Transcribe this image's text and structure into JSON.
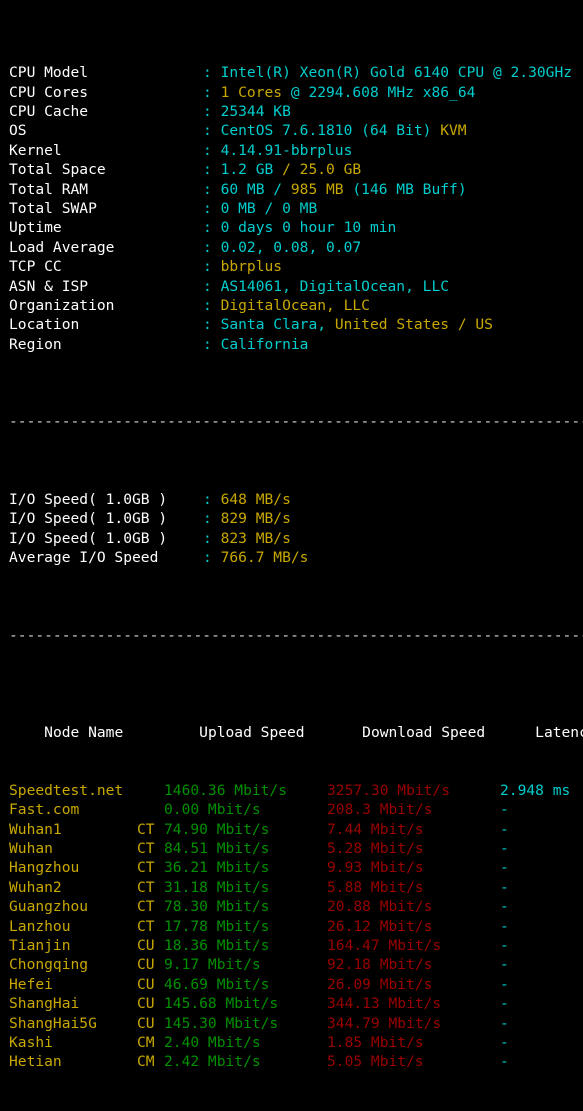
{
  "terminal": {
    "colors": {
      "background": "#000000",
      "label": "#ffffff",
      "cyan": "#00cdcd",
      "yellow": "#c8a800",
      "green": "#009000",
      "red": "#990000",
      "divider": "#cfd8d8"
    },
    "divider": "-------------------------------------------------------------------------------"
  },
  "sysinfo": [
    {
      "label": "CPU Model",
      "sep": ":",
      "parts": [
        {
          "text": "Intel(R) Xeon(R) Gold 6140 CPU @ 2.30GHz",
          "color": "cyan"
        }
      ]
    },
    {
      "label": "CPU Cores",
      "sep": ":",
      "parts": [
        {
          "text": "1 Cores",
          "color": "yellow"
        },
        {
          "text": " @ 2294.608 MHz ",
          "color": "cyan"
        },
        {
          "text": "x86_64",
          "color": "cyan"
        }
      ]
    },
    {
      "label": "CPU Cache",
      "sep": ":",
      "parts": [
        {
          "text": "25344 KB",
          "color": "cyan"
        }
      ]
    },
    {
      "label": "OS",
      "sep": ":",
      "parts": [
        {
          "text": "CentOS 7.6.1810 (64 Bit) ",
          "color": "cyan"
        },
        {
          "text": "KVM",
          "color": "yellow"
        }
      ]
    },
    {
      "label": "Kernel",
      "sep": ":",
      "parts": [
        {
          "text": "4.14.91-bbrplus",
          "color": "cyan"
        }
      ]
    },
    {
      "label": "Total Space",
      "sep": ":",
      "parts": [
        {
          "text": "1.2 GB ",
          "color": "cyan"
        },
        {
          "text": "/ 25.0 GB",
          "color": "yellow"
        }
      ]
    },
    {
      "label": "Total RAM",
      "sep": ":",
      "parts": [
        {
          "text": "60 MB / ",
          "color": "cyan"
        },
        {
          "text": "985 MB",
          "color": "yellow"
        },
        {
          "text": " (146 MB Buff)",
          "color": "cyan"
        }
      ]
    },
    {
      "label": "Total SWAP",
      "sep": ":",
      "parts": [
        {
          "text": "0 MB / 0 MB",
          "color": "cyan"
        }
      ]
    },
    {
      "label": "Uptime",
      "sep": ":",
      "parts": [
        {
          "text": "0 days 0 hour 10 min",
          "color": "cyan"
        }
      ]
    },
    {
      "label": "Load Average",
      "sep": ":",
      "parts": [
        {
          "text": "0.02, 0.08, 0.07",
          "color": "cyan"
        }
      ]
    },
    {
      "label": "TCP CC",
      "sep": ":",
      "parts": [
        {
          "text": "bbrplus",
          "color": "yellow"
        }
      ]
    },
    {
      "label": "ASN & ISP",
      "sep": ":",
      "parts": [
        {
          "text": "AS14061, DigitalOcean, LLC",
          "color": "cyan"
        }
      ]
    },
    {
      "label": "Organization",
      "sep": ":",
      "parts": [
        {
          "text": "DigitalOcean, LLC",
          "color": "yellow"
        }
      ]
    },
    {
      "label": "Location",
      "sep": ":",
      "parts": [
        {
          "text": "Santa Clara, ",
          "color": "cyan"
        },
        {
          "text": "United States / US",
          "color": "yellow"
        }
      ]
    },
    {
      "label": "Region",
      "sep": ":",
      "parts": [
        {
          "text": "California",
          "color": "cyan"
        }
      ]
    }
  ],
  "iospeed": [
    {
      "label": "I/O Speed( 1.0GB )",
      "sep": ":",
      "parts": [
        {
          "text": "648 MB/s",
          "color": "yellow"
        }
      ]
    },
    {
      "label": "I/O Speed( 1.0GB )",
      "sep": ":",
      "parts": [
        {
          "text": "829 MB/s",
          "color": "yellow"
        }
      ]
    },
    {
      "label": "I/O Speed( 1.0GB )",
      "sep": ":",
      "parts": [
        {
          "text": "823 MB/s",
          "color": "yellow"
        }
      ]
    },
    {
      "label": "Average I/O Speed",
      "sep": ":",
      "parts": [
        {
          "text": "766.7 MB/s",
          "color": "yellow"
        }
      ]
    }
  ],
  "speedtest": {
    "headers": {
      "node": "Node Name",
      "upload": "Upload Speed",
      "download": "Download Speed",
      "latency": "Latency"
    },
    "rows": [
      {
        "node": "Speedtest.net",
        "isp": "",
        "upload": "1460.36 Mbit/s",
        "download": "3257.30 Mbit/s",
        "latency": "2.948 ms"
      },
      {
        "node": "Fast.com",
        "isp": "",
        "upload": "0.00 Mbit/s",
        "download": "208.3 Mbit/s",
        "latency": "-"
      },
      {
        "node": "Wuhan1",
        "isp": "CT",
        "upload": "74.90 Mbit/s",
        "download": "7.44 Mbit/s",
        "latency": "-"
      },
      {
        "node": "Wuhan",
        "isp": "CT",
        "upload": "84.51 Mbit/s",
        "download": "5.28 Mbit/s",
        "latency": "-"
      },
      {
        "node": "Hangzhou",
        "isp": "CT",
        "upload": "36.21 Mbit/s",
        "download": "9.93 Mbit/s",
        "latency": "-"
      },
      {
        "node": "Wuhan2",
        "isp": "CT",
        "upload": "31.18 Mbit/s",
        "download": "5.88 Mbit/s",
        "latency": "-"
      },
      {
        "node": "Guangzhou",
        "isp": "CT",
        "upload": "78.30 Mbit/s",
        "download": "20.88 Mbit/s",
        "latency": "-"
      },
      {
        "node": "Lanzhou",
        "isp": "CT",
        "upload": "17.78 Mbit/s",
        "download": "26.12 Mbit/s",
        "latency": "-"
      },
      {
        "node": "Tianjin",
        "isp": "CU",
        "upload": "18.36 Mbit/s",
        "download": "164.47 Mbit/s",
        "latency": "-"
      },
      {
        "node": "Chongqing",
        "isp": "CU",
        "upload": "9.17 Mbit/s",
        "download": "92.18 Mbit/s",
        "latency": "-"
      },
      {
        "node": "Hefei",
        "isp": "CU",
        "upload": "46.69 Mbit/s",
        "download": "26.09 Mbit/s",
        "latency": "-"
      },
      {
        "node": "ShangHai",
        "isp": "CU",
        "upload": "145.68 Mbit/s",
        "download": "344.13 Mbit/s",
        "latency": "-"
      },
      {
        "node": "ShangHai5G",
        "isp": "CU",
        "upload": "145.30 Mbit/s",
        "download": "344.79 Mbit/s",
        "latency": "-"
      },
      {
        "node": "Kashi",
        "isp": "CM",
        "upload": "2.40 Mbit/s",
        "download": "1.85 Mbit/s",
        "latency": "-"
      },
      {
        "node": "Hetian",
        "isp": "CM",
        "upload": "2.42 Mbit/s",
        "download": "5.05 Mbit/s",
        "latency": "-"
      }
    ]
  }
}
